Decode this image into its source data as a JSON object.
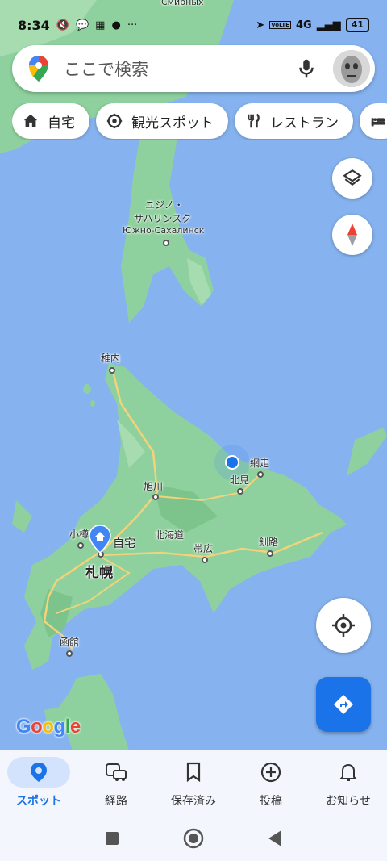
{
  "status_bar": {
    "time": "8:34",
    "network": "4G",
    "volte": "VoLTE",
    "battery": "41",
    "more": "···"
  },
  "search": {
    "placeholder": "ここで検索"
  },
  "chips": [
    {
      "label": "自宅",
      "icon": "home-icon"
    },
    {
      "label": "観光スポット",
      "icon": "landmark-icon"
    },
    {
      "label": "レストラン",
      "icon": "restaurant-icon"
    },
    {
      "label": "",
      "icon": "hotel-icon"
    }
  ],
  "map_labels": {
    "top_cut": "Смирных",
    "yuzhno_jp_1": "ユジノ・",
    "yuzhno_jp_2": "サハリンスク",
    "yuzhno_ru": "Южно-Сахалинск",
    "wakkanai": "稚内",
    "abashiri": "網走",
    "kitami": "北見",
    "asahikawa": "旭川",
    "hokkaido": "北海道",
    "otaru": "小樽",
    "home": "自宅",
    "sapporo": "札幌",
    "obihiro": "帯広",
    "kushiro": "釧路",
    "hakodate": "函館"
  },
  "google_logo": "Google",
  "bottom_nav": [
    {
      "label": "スポット",
      "icon": "explore-pin-icon",
      "active": true
    },
    {
      "label": "経路",
      "icon": "commute-icon",
      "active": false
    },
    {
      "label": "保存済み",
      "icon": "bookmark-icon",
      "active": false
    },
    {
      "label": "投稿",
      "icon": "contribute-icon",
      "active": false
    },
    {
      "label": "お知らせ",
      "icon": "bell-icon",
      "active": false
    }
  ],
  "colors": {
    "water": "#86b3ef",
    "land": "#8fd19e",
    "accent": "#1a73e8"
  }
}
